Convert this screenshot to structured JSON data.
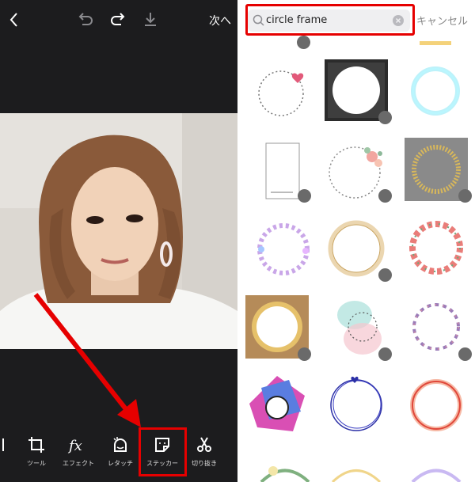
{
  "editor": {
    "next_label": "次へ",
    "tools": [
      {
        "label": "ツール",
        "icon": "crop-icon"
      },
      {
        "label": "エフェクト",
        "icon": "fx-icon"
      },
      {
        "label": "レタッチ",
        "icon": "retouch-icon"
      },
      {
        "label": "ステッカー",
        "icon": "sticker-icon"
      },
      {
        "label": "切り抜き",
        "icon": "cutout-icon"
      }
    ],
    "highlight_color": "#e60000"
  },
  "sticker_search": {
    "query": "circle frame",
    "cancel_label": "キャンセル",
    "results": [
      {
        "name": "dotted-circle-heart",
        "premium": false
      },
      {
        "name": "black-grunge-circle",
        "premium": true
      },
      {
        "name": "neon-blue-ring",
        "premium": false
      },
      {
        "name": "paper-card-frame",
        "premium": true
      },
      {
        "name": "floral-dotted-circle",
        "premium": true
      },
      {
        "name": "gold-glitter-ring",
        "premium": true
      },
      {
        "name": "bubble-circle",
        "premium": false
      },
      {
        "name": "gold-glitter-circle",
        "premium": true
      },
      {
        "name": "flower-wreath",
        "premium": false
      },
      {
        "name": "ornate-gold-frame",
        "premium": true
      },
      {
        "name": "watercolor-dotted-circle",
        "premium": true
      },
      {
        "name": "feather-wreath",
        "premium": true
      },
      {
        "name": "colorful-abstract-circle",
        "premium": false
      },
      {
        "name": "blue-scribble-circle",
        "premium": false
      },
      {
        "name": "orange-glow-ring",
        "premium": false
      }
    ]
  }
}
